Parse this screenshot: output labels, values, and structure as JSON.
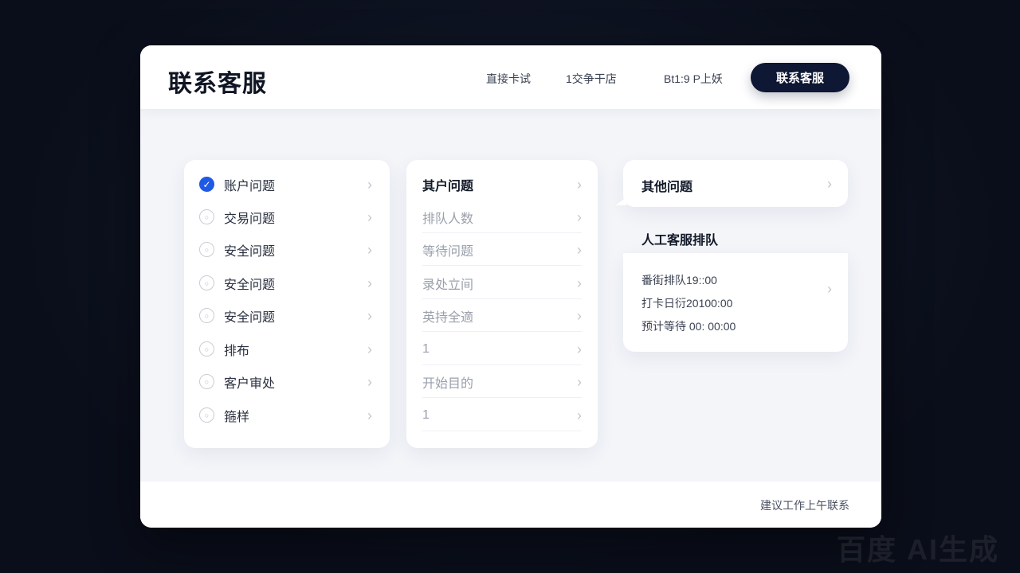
{
  "header": {
    "title": "联系客服",
    "nav": [
      "直接卡试",
      "1交争干店",
      "Bt1:9 P上妖"
    ],
    "contact_button": "联系客服"
  },
  "left_menu": {
    "items": [
      {
        "label": "账户问题",
        "checked": true
      },
      {
        "label": "交易问题",
        "checked": false
      },
      {
        "label": "安全问题",
        "checked": false
      },
      {
        "label": "安全问题",
        "checked": false
      },
      {
        "label": "安全问题",
        "checked": false
      },
      {
        "label": "排布",
        "checked": false
      },
      {
        "label": "客户审处",
        "checked": false
      },
      {
        "label": "箍样",
        "checked": false
      }
    ]
  },
  "mid_menu": {
    "items": [
      {
        "label": "其户问题",
        "style": "bold"
      },
      {
        "label": "排队人数",
        "style": "muted"
      },
      {
        "label": "等待问题",
        "style": "muted"
      },
      {
        "label": "录处立间",
        "style": "muted"
      },
      {
        "label": "英持全適",
        "style": "muted"
      },
      {
        "label": "1",
        "style": "muted"
      },
      {
        "label": "开始目的",
        "style": "muted"
      },
      {
        "label": "1",
        "style": "muted"
      }
    ]
  },
  "right_panel": {
    "other_label": "其他问题",
    "queue_title": "人工客服排队",
    "queue_lines": [
      "番街排队19::00",
      "打卡日衍20100:00",
      "预计等待 00: 00:00"
    ]
  },
  "footer": {
    "note": "建议工作上午联系"
  },
  "watermark": "百度 AI生成",
  "colors": {
    "accent": "#1f5ae6",
    "button_bg": "#0e1733",
    "page_bg": "#0b1020"
  },
  "icons": {
    "chevron": "chevron-right-icon",
    "check": "check-circle-icon",
    "radio": "radio-circle-icon"
  }
}
